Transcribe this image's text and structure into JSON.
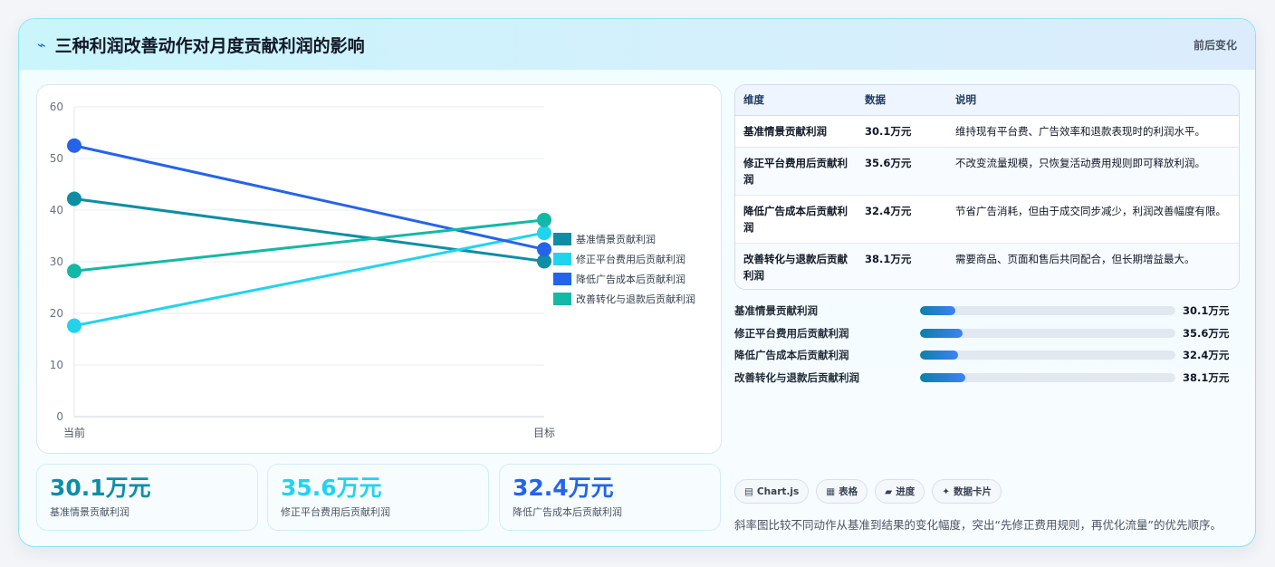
{
  "header": {
    "icon": "zap-icon",
    "title": "三种利润改善动作对月度贡献利润的影响",
    "tag": "前后变化"
  },
  "colors": {
    "baseline": "#0e8ea5",
    "platform": "#22d3ee",
    "ads": "#2563eb",
    "conversion": "#14b8a6"
  },
  "chart_data": {
    "type": "line",
    "categories": [
      "当前",
      "目标"
    ],
    "ylim": [
      0,
      60
    ],
    "yticks": [
      0,
      10,
      20,
      30,
      40,
      50,
      60
    ],
    "series": [
      {
        "name": "基准情景贡献利润",
        "values": [
          42.2,
          30.1
        ],
        "color": "#0e8ea5"
      },
      {
        "name": "修正平台费用后贡献利润",
        "values": [
          17.6,
          35.6
        ],
        "color": "#22d3ee"
      },
      {
        "name": "降低广告成本后贡献利润",
        "values": [
          52.5,
          32.4
        ],
        "color": "#2563eb"
      },
      {
        "name": "改善转化与退款后贡献利润",
        "values": [
          28.2,
          38.1
        ],
        "color": "#14b8a6"
      }
    ],
    "legend": "right"
  },
  "table": {
    "headers": [
      "维度",
      "数据",
      "说明"
    ],
    "rows": [
      {
        "dim": "基准情景贡献利润",
        "val": "30.1万元",
        "desc": "维持现有平台费、广告效率和退款表现时的利润水平。"
      },
      {
        "dim": "修正平台费用后贡献利润",
        "val": "35.6万元",
        "desc": "不改变流量规模，只恢复活动费用规则即可释放利润。"
      },
      {
        "dim": "降低广告成本后贡献利润",
        "val": "32.4万元",
        "desc": "节省广告消耗，但由于成交同步减少，利润改善幅度有限。"
      },
      {
        "dim": "改善转化与退款后贡献利润",
        "val": "38.1万元",
        "desc": "需要商品、页面和售后共同配合，但长期增益最大。"
      }
    ]
  },
  "progress": [
    {
      "label": "基准情景贡献利润",
      "value": "30.1万元",
      "fraction": 0.14
    },
    {
      "label": "修正平台费用后贡献利润",
      "value": "35.6万元",
      "fraction": 0.165
    },
    {
      "label": "降低广告成本后贡献利润",
      "value": "32.4万元",
      "fraction": 0.15
    },
    {
      "label": "改善转化与退款后贡献利润",
      "value": "38.1万元",
      "fraction": 0.177
    }
  ],
  "stats": [
    {
      "value": "30.1万元",
      "label": "基准情景贡献利润",
      "color": "#0e8ea5"
    },
    {
      "value": "35.6万元",
      "label": "修正平台费用后贡献利润",
      "color": "#22d3ee"
    },
    {
      "value": "32.4万元",
      "label": "降低广告成本后贡献利润",
      "color": "#2563eb"
    }
  ],
  "chips": [
    {
      "icon": "chart-icon",
      "glyph": "▤",
      "label": "Chart.js"
    },
    {
      "icon": "table-icon",
      "glyph": "▦",
      "label": "表格"
    },
    {
      "icon": "progress-icon",
      "glyph": "▰",
      "label": "进度"
    },
    {
      "icon": "sparkle-icon",
      "glyph": "✦",
      "label": "数据卡片"
    }
  ],
  "note": "斜率图比较不同动作从基准到结果的变化幅度，突出“先修正费用规则，再优化流量”的优先顺序。"
}
